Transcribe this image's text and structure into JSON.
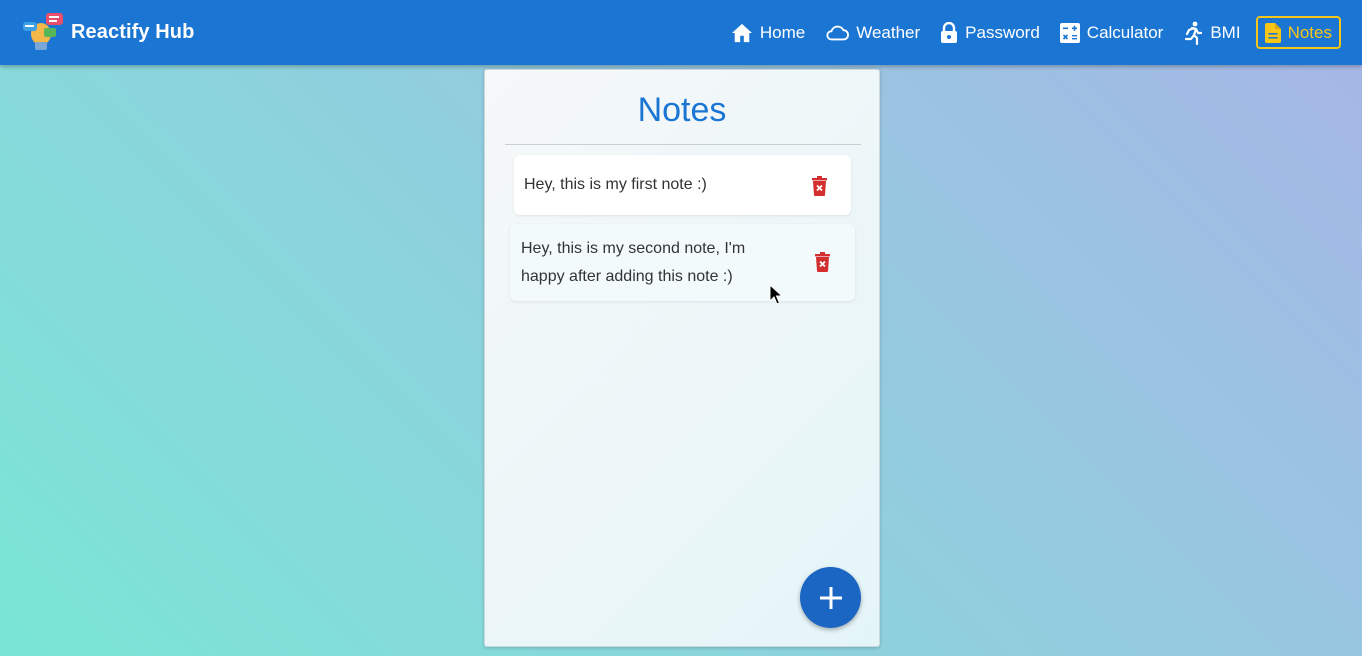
{
  "app": {
    "title": "Reactify Hub"
  },
  "nav": {
    "home": "Home",
    "weather": "Weather",
    "password": "Password",
    "calculator": "Calculator",
    "bmi": "BMI",
    "notes": "Notes"
  },
  "page": {
    "heading": "Notes"
  },
  "notes": [
    {
      "text": "Hey, this is my first note :)"
    },
    {
      "text": "Hey, this is my second note, I'm happy after adding this note :)"
    }
  ],
  "icons": {
    "home": "home-icon",
    "weather": "cloud-icon",
    "password": "lock-icon",
    "calculator": "calculator-icon",
    "bmi": "running-person-icon",
    "notes": "document-icon",
    "delete": "trash-icon",
    "add": "plus-icon"
  },
  "colors": {
    "navbar": "#1b76d3",
    "active_nav": "#f5c518",
    "heading": "#1b76d3",
    "delete_icon": "#d32f2f",
    "fab": "#1a66c2"
  }
}
